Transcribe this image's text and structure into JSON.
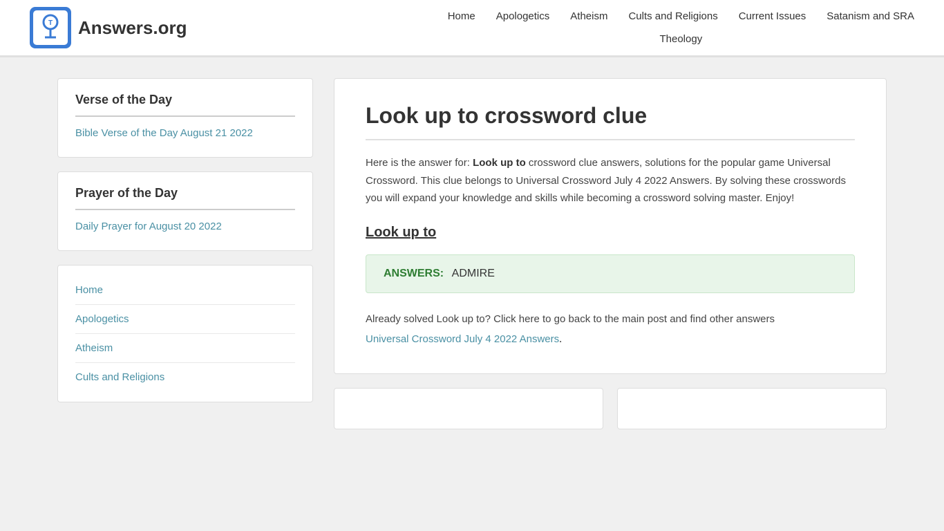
{
  "header": {
    "logo_text": "Answers.org",
    "nav_top": [
      {
        "label": "Home",
        "href": "#"
      },
      {
        "label": "Apologetics",
        "href": "#"
      },
      {
        "label": "Atheism",
        "href": "#"
      },
      {
        "label": "Cults and Religions",
        "href": "#"
      },
      {
        "label": "Current Issues",
        "href": "#"
      },
      {
        "label": "Satanism and SRA",
        "href": "#"
      }
    ],
    "nav_bottom": [
      {
        "label": "Theology",
        "href": "#"
      }
    ]
  },
  "sidebar": {
    "verse_card": {
      "title": "Verse of the Day",
      "link_text": "Bible Verse of the Day August 21 2022"
    },
    "prayer_card": {
      "title": "Prayer of the Day",
      "link_text": "Daily Prayer for August 20 2022"
    },
    "nav_items": [
      {
        "label": "Home"
      },
      {
        "label": "Apologetics"
      },
      {
        "label": "Atheism"
      },
      {
        "label": "Cults and Religions"
      }
    ]
  },
  "main": {
    "title": "Look up to crossword clue",
    "body_text_1": "Here is the answer for:",
    "body_bold": "Look up to",
    "body_text_2": "crossword clue answers, solutions for the popular game Universal Crossword. This clue belongs to Universal Crossword July 4 2022 Answers. By solving these crosswords you will expand your knowledge and skills while becoming a crossword solving master. Enjoy!",
    "clue_heading": "Look up to",
    "answers_label": "ANSWERS:",
    "answers_value": "ADMIRE",
    "solved_text": "Already solved Look up to? Click here to go back to the main post and find other answers",
    "solved_link": "Universal Crossword July 4 2022 Answers",
    "solved_period": "."
  },
  "colors": {
    "accent": "#4a90a4",
    "answer_bg": "#e8f5e9",
    "answer_border": "#c8e6c9",
    "answer_label": "#2e7d32"
  }
}
